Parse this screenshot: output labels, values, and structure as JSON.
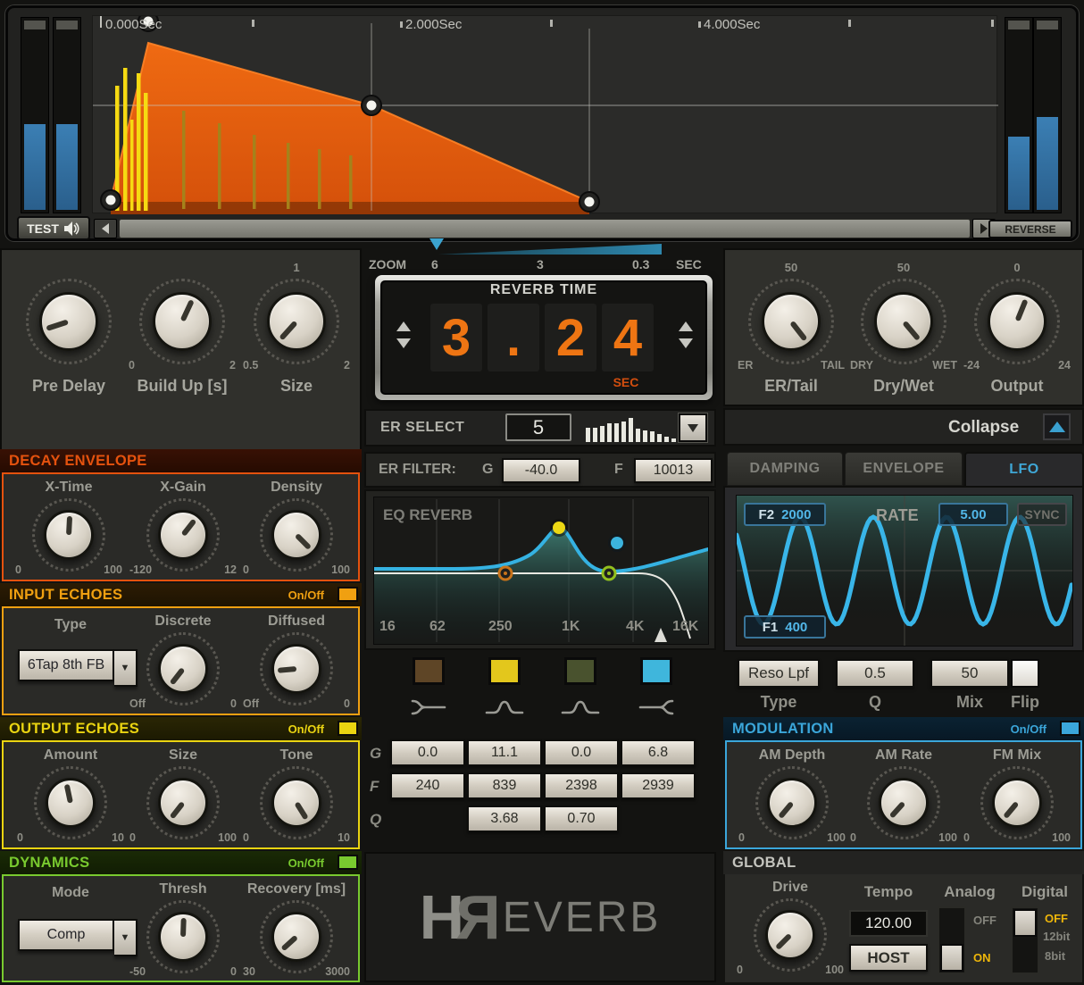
{
  "colors": {
    "decay": "#e5520e",
    "input": "#f0a011",
    "output": "#ead411",
    "dynamics": "#79ca2f",
    "modulation": "#3ba6da",
    "global": "#55554f",
    "accent_blue": "#3aa0d0",
    "digit_orange": "#ee7513",
    "meter_blue": "#2f6b9d",
    "envelope_orange": "#e55a0e",
    "wave_cyan": "#36b3e6"
  },
  "transport": {
    "test": "TEST",
    "reverse": "REVERSE",
    "timeline": [
      "0.000Sec",
      "2.000Sec",
      "4.000Sec"
    ]
  },
  "zoom_bar": {
    "label": "ZOOM",
    "ticks": [
      "6",
      "3",
      "0.3"
    ],
    "unit": "SEC"
  },
  "reverb_time": {
    "title": "REVERB TIME",
    "digits": [
      "3",
      ".",
      "2",
      "4"
    ],
    "unit": "SEC"
  },
  "er_select": {
    "label": "ER SELECT",
    "value": "5",
    "pattern": [
      16,
      16,
      18,
      21,
      21,
      23,
      27,
      15,
      13,
      12,
      9,
      6,
      4
    ]
  },
  "collapse": {
    "label": "Collapse"
  },
  "top_left": {
    "knobs": [
      {
        "label": "Pre Delay",
        "angle": -108
      },
      {
        "label": "Build Up [s]",
        "min": "0",
        "max": "2",
        "angle": 25
      },
      {
        "label": "Size",
        "min": "0.5",
        "max": "2",
        "top": "1",
        "angle": -138
      }
    ],
    "sync": "SYNC"
  },
  "top_right": {
    "knobs": [
      {
        "label": "ER/Tail",
        "min": "ER",
        "max": "TAIL",
        "top": "50",
        "angle": 142
      },
      {
        "label": "Dry/Wet",
        "min": "DRY",
        "max": "WET",
        "top": "50",
        "angle": 140
      },
      {
        "label": "Output",
        "min": "-24",
        "max": "24",
        "top": "0",
        "angle": 22
      }
    ]
  },
  "decay": {
    "title": "DECAY ENVELOPE",
    "knobs": [
      {
        "label": "X-Time",
        "min": "0",
        "max": "100",
        "angle": 3
      },
      {
        "label": "X-Gain",
        "min": "-120",
        "max": "12",
        "angle": 38
      },
      {
        "label": "Density",
        "min": "0",
        "max": "100",
        "angle": 135
      }
    ]
  },
  "input_echoes": {
    "title": "INPUT ECHOES",
    "onoff": "On/Off",
    "type_label": "Type",
    "type_value": "6Tap 8th FB",
    "knobs": [
      {
        "label": "Discrete",
        "min": "Off",
        "max": "0",
        "angle": -142
      },
      {
        "label": "Diffused",
        "min": "Off",
        "max": "0",
        "angle": -95
      }
    ]
  },
  "output_echoes": {
    "title": "OUTPUT ECHOES",
    "onoff": "On/Off",
    "knobs": [
      {
        "label": "Amount",
        "min": "0",
        "max": "10",
        "angle": -12
      },
      {
        "label": "Size",
        "min": "0",
        "max": "100",
        "angle": -142
      },
      {
        "label": "Tone",
        "min": "0",
        "max": "10",
        "angle": 148
      }
    ]
  },
  "dynamics": {
    "title": "DYNAMICS",
    "onoff": "On/Off",
    "mode_label": "Mode",
    "mode_value": "Comp",
    "knobs": [
      {
        "label": "Thresh",
        "min": "-50",
        "max": "0",
        "angle": 2
      },
      {
        "label": "Recovery [ms]",
        "min": "30",
        "max": "3000",
        "angle": -132
      }
    ]
  },
  "er_filter": {
    "title": "ER FILTER:",
    "g_label": "G",
    "g_value": "-40.0",
    "f_label": "F",
    "f_value": "10013"
  },
  "eq": {
    "title": "EQ REVERB",
    "freqs": [
      "16",
      "62",
      "250",
      "1K",
      "4K",
      "16K"
    ],
    "row_labels": [
      "G",
      "F",
      "Q"
    ],
    "g_values": [
      "0.0",
      "11.1",
      "0.0",
      "6.8"
    ],
    "f_values": [
      "240",
      "839",
      "2398",
      "2939"
    ],
    "q_values": [
      "3.68",
      "0.70"
    ],
    "band_colors": [
      "#5e4526",
      "#e3c71c",
      "#49522e",
      "#3fb6dc"
    ]
  },
  "tabs": {
    "items": [
      "DAMPING",
      "ENVELOPE",
      "LFO"
    ],
    "active": "LFO"
  },
  "lfo": {
    "f2_label": "F2",
    "f2_value": "2000",
    "rate_label": "RATE",
    "rate_value": "5.00",
    "sync": "SYNC",
    "f1_label": "F1",
    "f1_value": "400",
    "type_value": "Reso Lpf",
    "q_value": "0.5",
    "mix_value": "50",
    "type_label": "Type",
    "q_label": "Q",
    "mix_label": "Mix",
    "flip_label": "Flip"
  },
  "modulation": {
    "title": "MODULATION",
    "onoff": "On/Off",
    "knobs": [
      {
        "label": "AM Depth",
        "min": "0",
        "max": "100",
        "angle": -140
      },
      {
        "label": "AM Rate",
        "min": "0",
        "max": "100",
        "angle": -138
      },
      {
        "label": "FM Mix",
        "min": "0",
        "max": "100",
        "angle": -140
      }
    ]
  },
  "global": {
    "title": "GLOBAL",
    "drive": {
      "label": "Drive",
      "min": "0",
      "max": "100",
      "angle": -135
    },
    "tempo_label": "Tempo",
    "tempo_value": "120.00",
    "host": "HOST",
    "analog_label": "Analog",
    "analog_off": "OFF",
    "analog_on": "ON",
    "digital_label": "Digital",
    "digital_off": "OFF",
    "digital_12bit": "12bit",
    "digital_8bit": "8bit"
  },
  "logo": {
    "h": "H",
    "r": "R",
    "rest": "EVERB"
  }
}
